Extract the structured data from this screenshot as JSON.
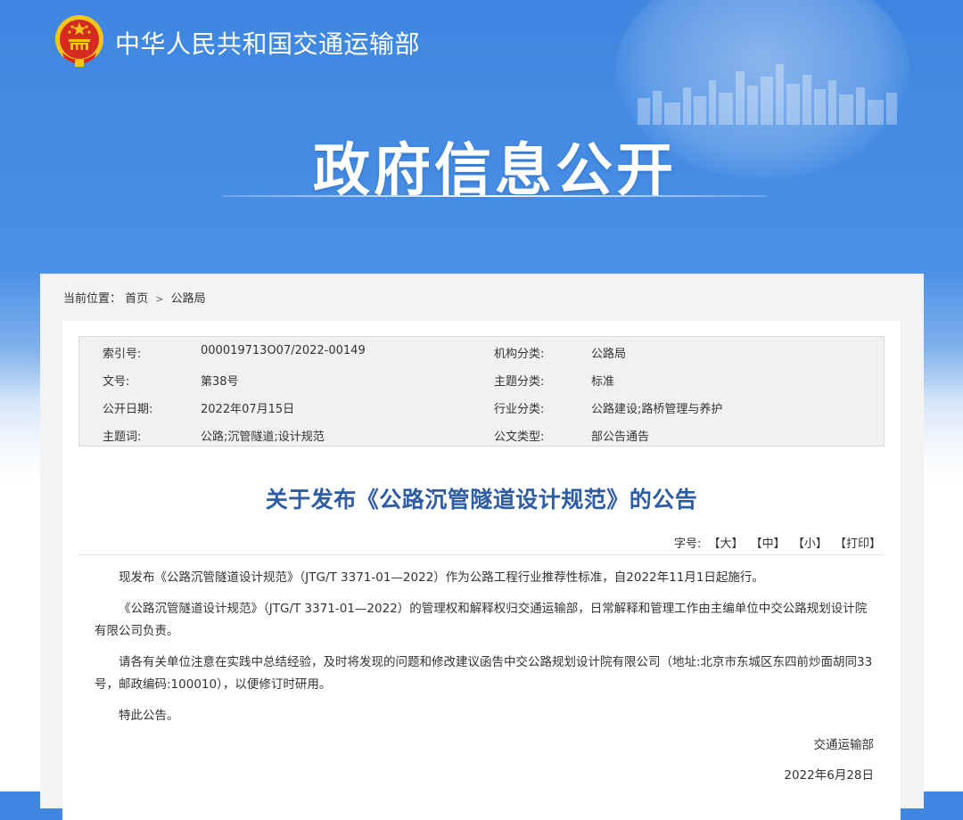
{
  "header": {
    "ministry_name": "中华人民共和国交通运输部",
    "banner_title": "政府信息公开"
  },
  "breadcrumb": {
    "prefix": "当前位置：",
    "items": [
      "首页",
      "公路局"
    ],
    "separator": ">"
  },
  "info": {
    "rows": [
      {
        "label1": "索引号:",
        "value1": "000019713O07/2022-00149",
        "label2": "机构分类:",
        "value2": "公路局"
      },
      {
        "label1": "文号:",
        "value1": "第38号",
        "label2": "主题分类:",
        "value2": "标准"
      },
      {
        "label1": "公开日期:",
        "value1": "2022年07月15日",
        "label2": "行业分类:",
        "value2": "公路建设;路桥管理与养护"
      },
      {
        "label1": "主题词:",
        "value1": "公路;沉管隧道;设计规范",
        "label2": "公文类型:",
        "value2": "部公告通告"
      }
    ]
  },
  "article": {
    "title": "关于发布《公路沉管隧道设计规范》的公告",
    "font_size_label": "字号:",
    "font_large": "【大】",
    "font_medium": "【中】",
    "font_small": "【小】",
    "print": "【打印】",
    "paragraphs": [
      "现发布《公路沉管隧道设计规范》（JTG/T 3371-01—2022）作为公路工程行业推荐性标准，自2022年11月1日起施行。",
      "《公路沉管隧道设计规范》（JTG/T 3371-01—2022）的管理权和解释权归交通运输部，日常解释和管理工作由主编单位中交公路规划设计院有限公司负责。",
      "请各有关单位注意在实践中总结经验，及时将发现的问题和修改建议函告中交公路规划设计院有限公司（地址:北京市东城区东四前炒面胡同33号，邮政编码:100010），以便修订时研用。",
      "特此公告。"
    ],
    "signature_org": "交通运输部",
    "signature_date": "2022年6月28日"
  },
  "colors": {
    "banner_blue": "#4a90e6",
    "title_blue": "#2e5da5",
    "emblem_red": "#d42a1f",
    "emblem_gold": "#f5c518"
  }
}
